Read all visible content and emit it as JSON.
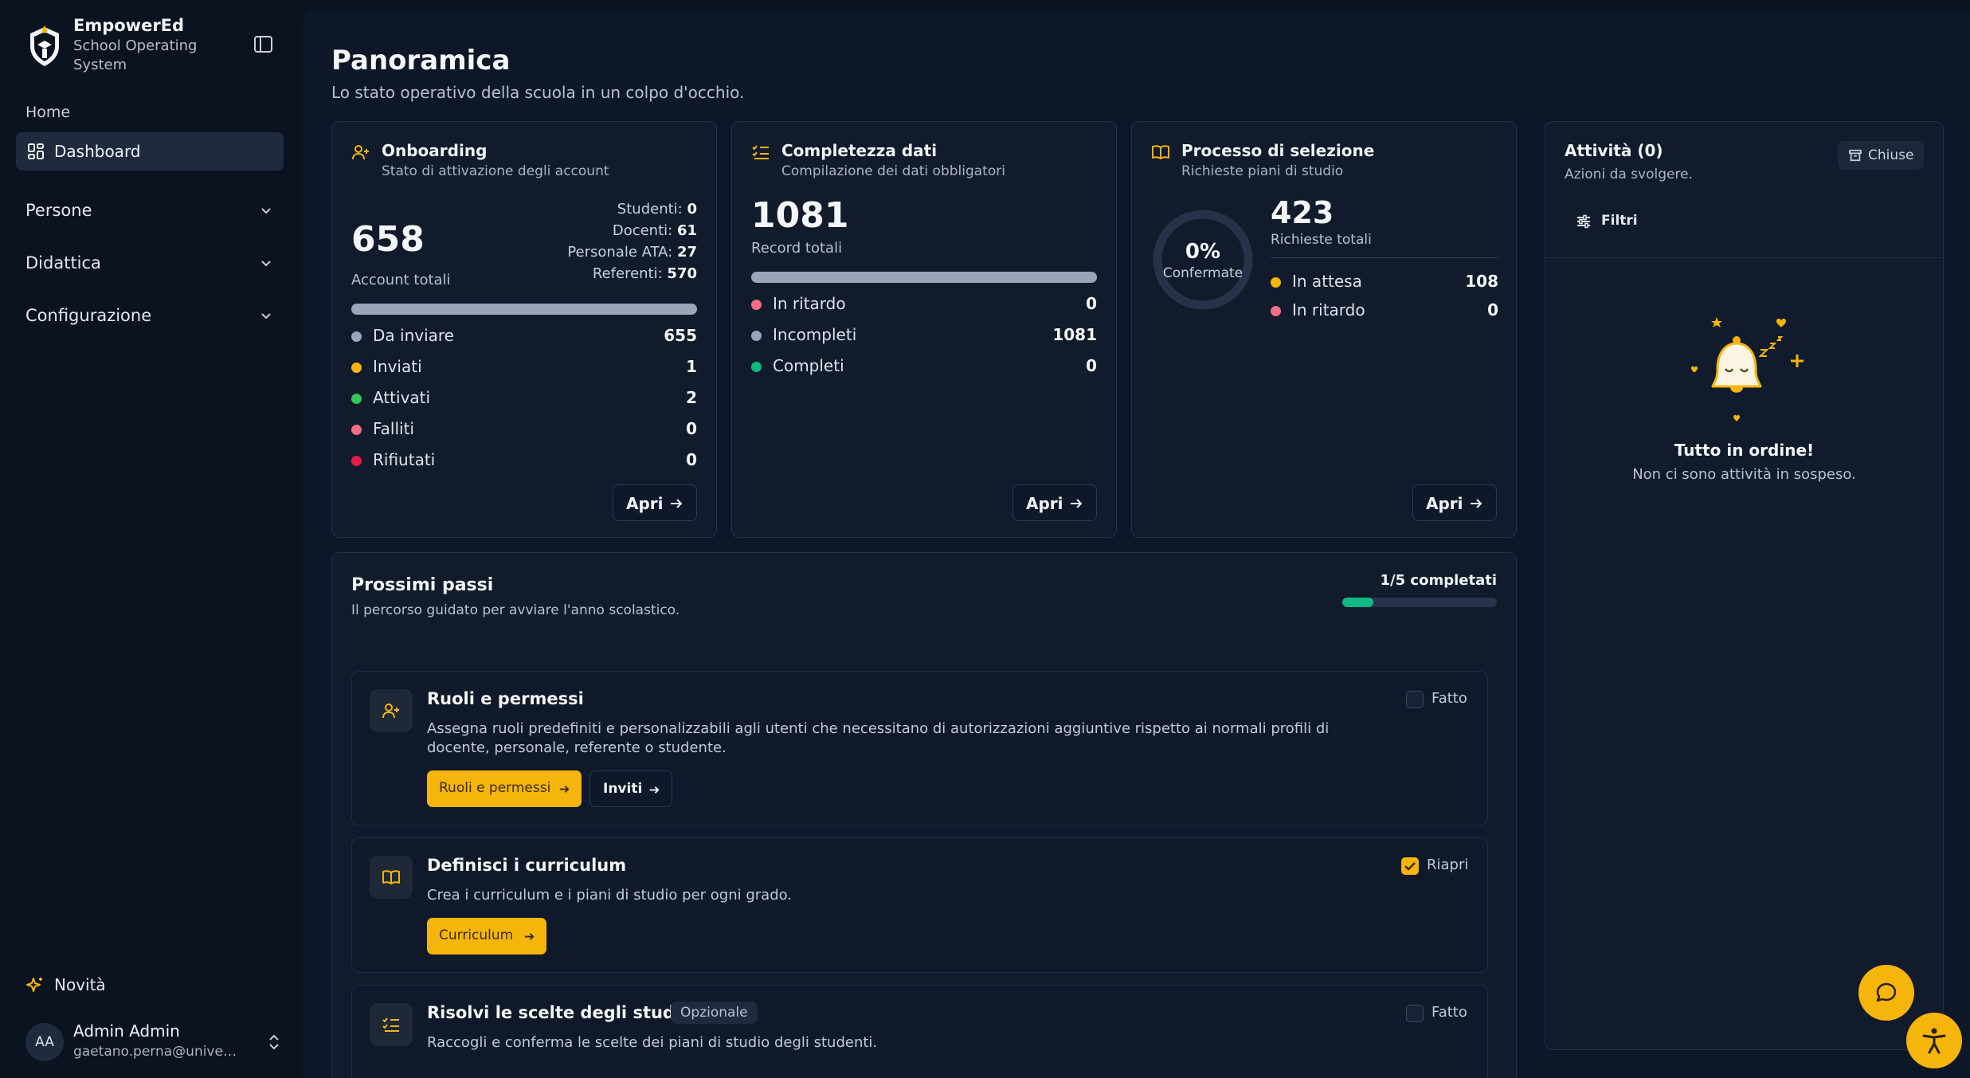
{
  "brand": {
    "name": "EmpowerEd",
    "subtitle": "School Operating System"
  },
  "sidebar": {
    "caption": "Home",
    "active": "Dashboard",
    "groups": [
      "Persone",
      "Didattica",
      "Configurazione"
    ],
    "novita": "Novità",
    "user": {
      "initials": "AA",
      "name": "Admin Admin",
      "email": "gaetano.perna@universi..."
    }
  },
  "page": {
    "title": "Panoramica",
    "subtitle": "Lo stato operativo della scuola in un colpo d'occhio."
  },
  "onboarding": {
    "title": "Onboarding",
    "subtitle": "Stato di attivazione degli account",
    "total": "658",
    "total_label": "Account totali",
    "breakdown": [
      {
        "label": "Studenti:",
        "value": "0"
      },
      {
        "label": "Docenti:",
        "value": "61"
      },
      {
        "label": "Personale ATA:",
        "value": "27"
      },
      {
        "label": "Referenti:",
        "value": "570"
      }
    ],
    "progress": 1.0,
    "rows": [
      {
        "label": "Da inviare",
        "value": "655",
        "color": "#9aa6b8"
      },
      {
        "label": "Inviati",
        "value": "1",
        "color": "#f5b50b"
      },
      {
        "label": "Attivati",
        "value": "2",
        "color": "#34c759"
      },
      {
        "label": "Falliti",
        "value": "0",
        "color": "#f26d85"
      },
      {
        "label": "Rifiutati",
        "value": "0",
        "color": "#e11d48"
      }
    ],
    "open": "Apri"
  },
  "data_completeness": {
    "title": "Completezza dati",
    "subtitle": "Compilazione dei dati obbligatori",
    "total": "1081",
    "total_label": "Record totali",
    "progress": 1.0,
    "rows": [
      {
        "label": "In ritardo",
        "value": "0",
        "color": "#f26d85"
      },
      {
        "label": "Incompleti",
        "value": "1081",
        "color": "#9aa6b8"
      },
      {
        "label": "Completi",
        "value": "0",
        "color": "#10b981"
      }
    ],
    "open": "Apri"
  },
  "selection": {
    "title": "Processo di selezione",
    "subtitle": "Richieste piani di studio",
    "percent": "0%",
    "percent_label": "Confermate",
    "total": "423",
    "total_label": "Richieste totali",
    "rows": [
      {
        "label": "In attesa",
        "value": "108",
        "color": "#f5b50b"
      },
      {
        "label": "In ritardo",
        "value": "0",
        "color": "#f26d85"
      }
    ],
    "open": "Apri"
  },
  "activity": {
    "title": "Attività (0)",
    "subtitle": "Azioni da svolgere.",
    "closed_label": "Chiuse",
    "filters_label": "Filtri",
    "empty_title": "Tutto in ordine!",
    "empty_sub": "Non ci sono attività in sospeso."
  },
  "next_steps": {
    "title": "Prossimi passi",
    "subtitle": "Il percorso guidato per avviare l'anno scolastico.",
    "count": "1/5 completati",
    "progress": 0.2,
    "steps": [
      {
        "title": "Ruoli e permessi",
        "desc": "Assegna ruoli predefiniti e personalizzabili agli utenti che necessitano di autorizzazioni aggiuntive rispetto ai normali profili di docente, personale, referente o studente.",
        "check_label": "Fatto",
        "checked": false,
        "primary": "Ruoli e permessi",
        "secondary": "Inviti"
      },
      {
        "title": "Definisci i curriculum",
        "desc": "Crea i curriculum e i piani di studio per ogni grado.",
        "check_label": "Riapri",
        "checked": true,
        "primary": "Curriculum"
      },
      {
        "title": "Risolvi le scelte degli studenti",
        "badge": "Opzionale",
        "desc": "Raccogli e conferma le scelte dei piani di studio degli studenti.",
        "check_label": "Fatto",
        "checked": false
      }
    ]
  },
  "colors": {
    "accent": "#f5b50b",
    "success": "#10b981",
    "surface": "#111b2c"
  }
}
